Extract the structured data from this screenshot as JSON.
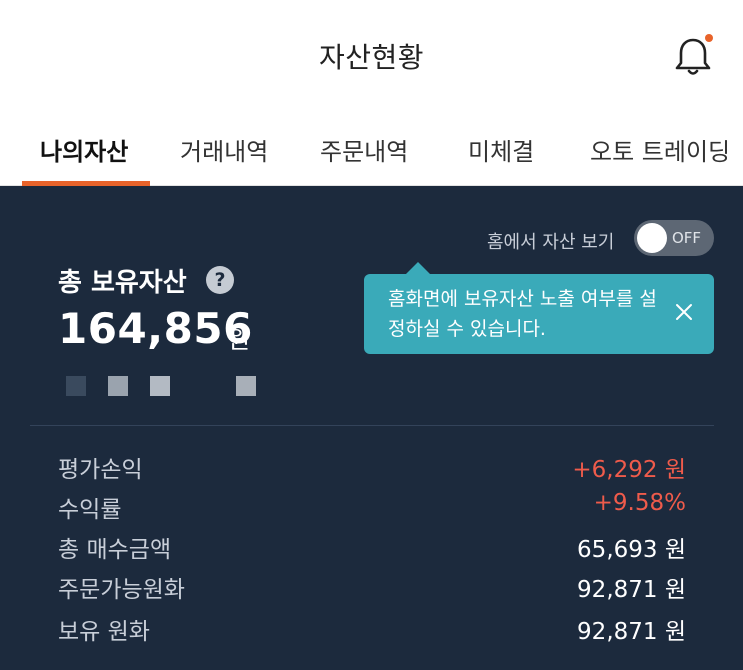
{
  "header": {
    "title": "자산현황",
    "bell_icon": "bell-icon",
    "notification_dot_color": "#e8632a"
  },
  "tabs": [
    {
      "label": "나의자산",
      "active": true
    },
    {
      "label": "거래내역",
      "active": false
    },
    {
      "label": "주문내역",
      "active": false
    },
    {
      "label": "미체결",
      "active": false
    },
    {
      "label": "오토 트레이딩",
      "active": false
    }
  ],
  "panel": {
    "home_toggle_label": "홈에서 자산 보기",
    "toggle_state": "OFF",
    "assets_title": "총 보유자산",
    "help_icon": "?",
    "total_amount": "164,856",
    "total_unit": "원",
    "tooltip": {
      "text": "홈화면에 보유자산 노출 여부를 설정하실 수 있습니다.",
      "close_icon": "close-icon"
    },
    "summary_rows": [
      {
        "label": "평가손익",
        "value": "+6,292 원",
        "positive": true
      },
      {
        "label": "수익률",
        "value": "+9.58%",
        "positive": true
      },
      {
        "label": "총 매수금액",
        "value": "65,693 원",
        "positive": false
      },
      {
        "label": "주문가능원화",
        "value": "92,871 원",
        "positive": false
      },
      {
        "label": "보유 원화",
        "value": "92,871 원",
        "positive": false
      }
    ]
  },
  "colors": {
    "accent": "#e8632a",
    "panel_bg": "#1c2a3d",
    "tooltip_bg": "#3aaab9",
    "positive": "#ef5b4b"
  }
}
